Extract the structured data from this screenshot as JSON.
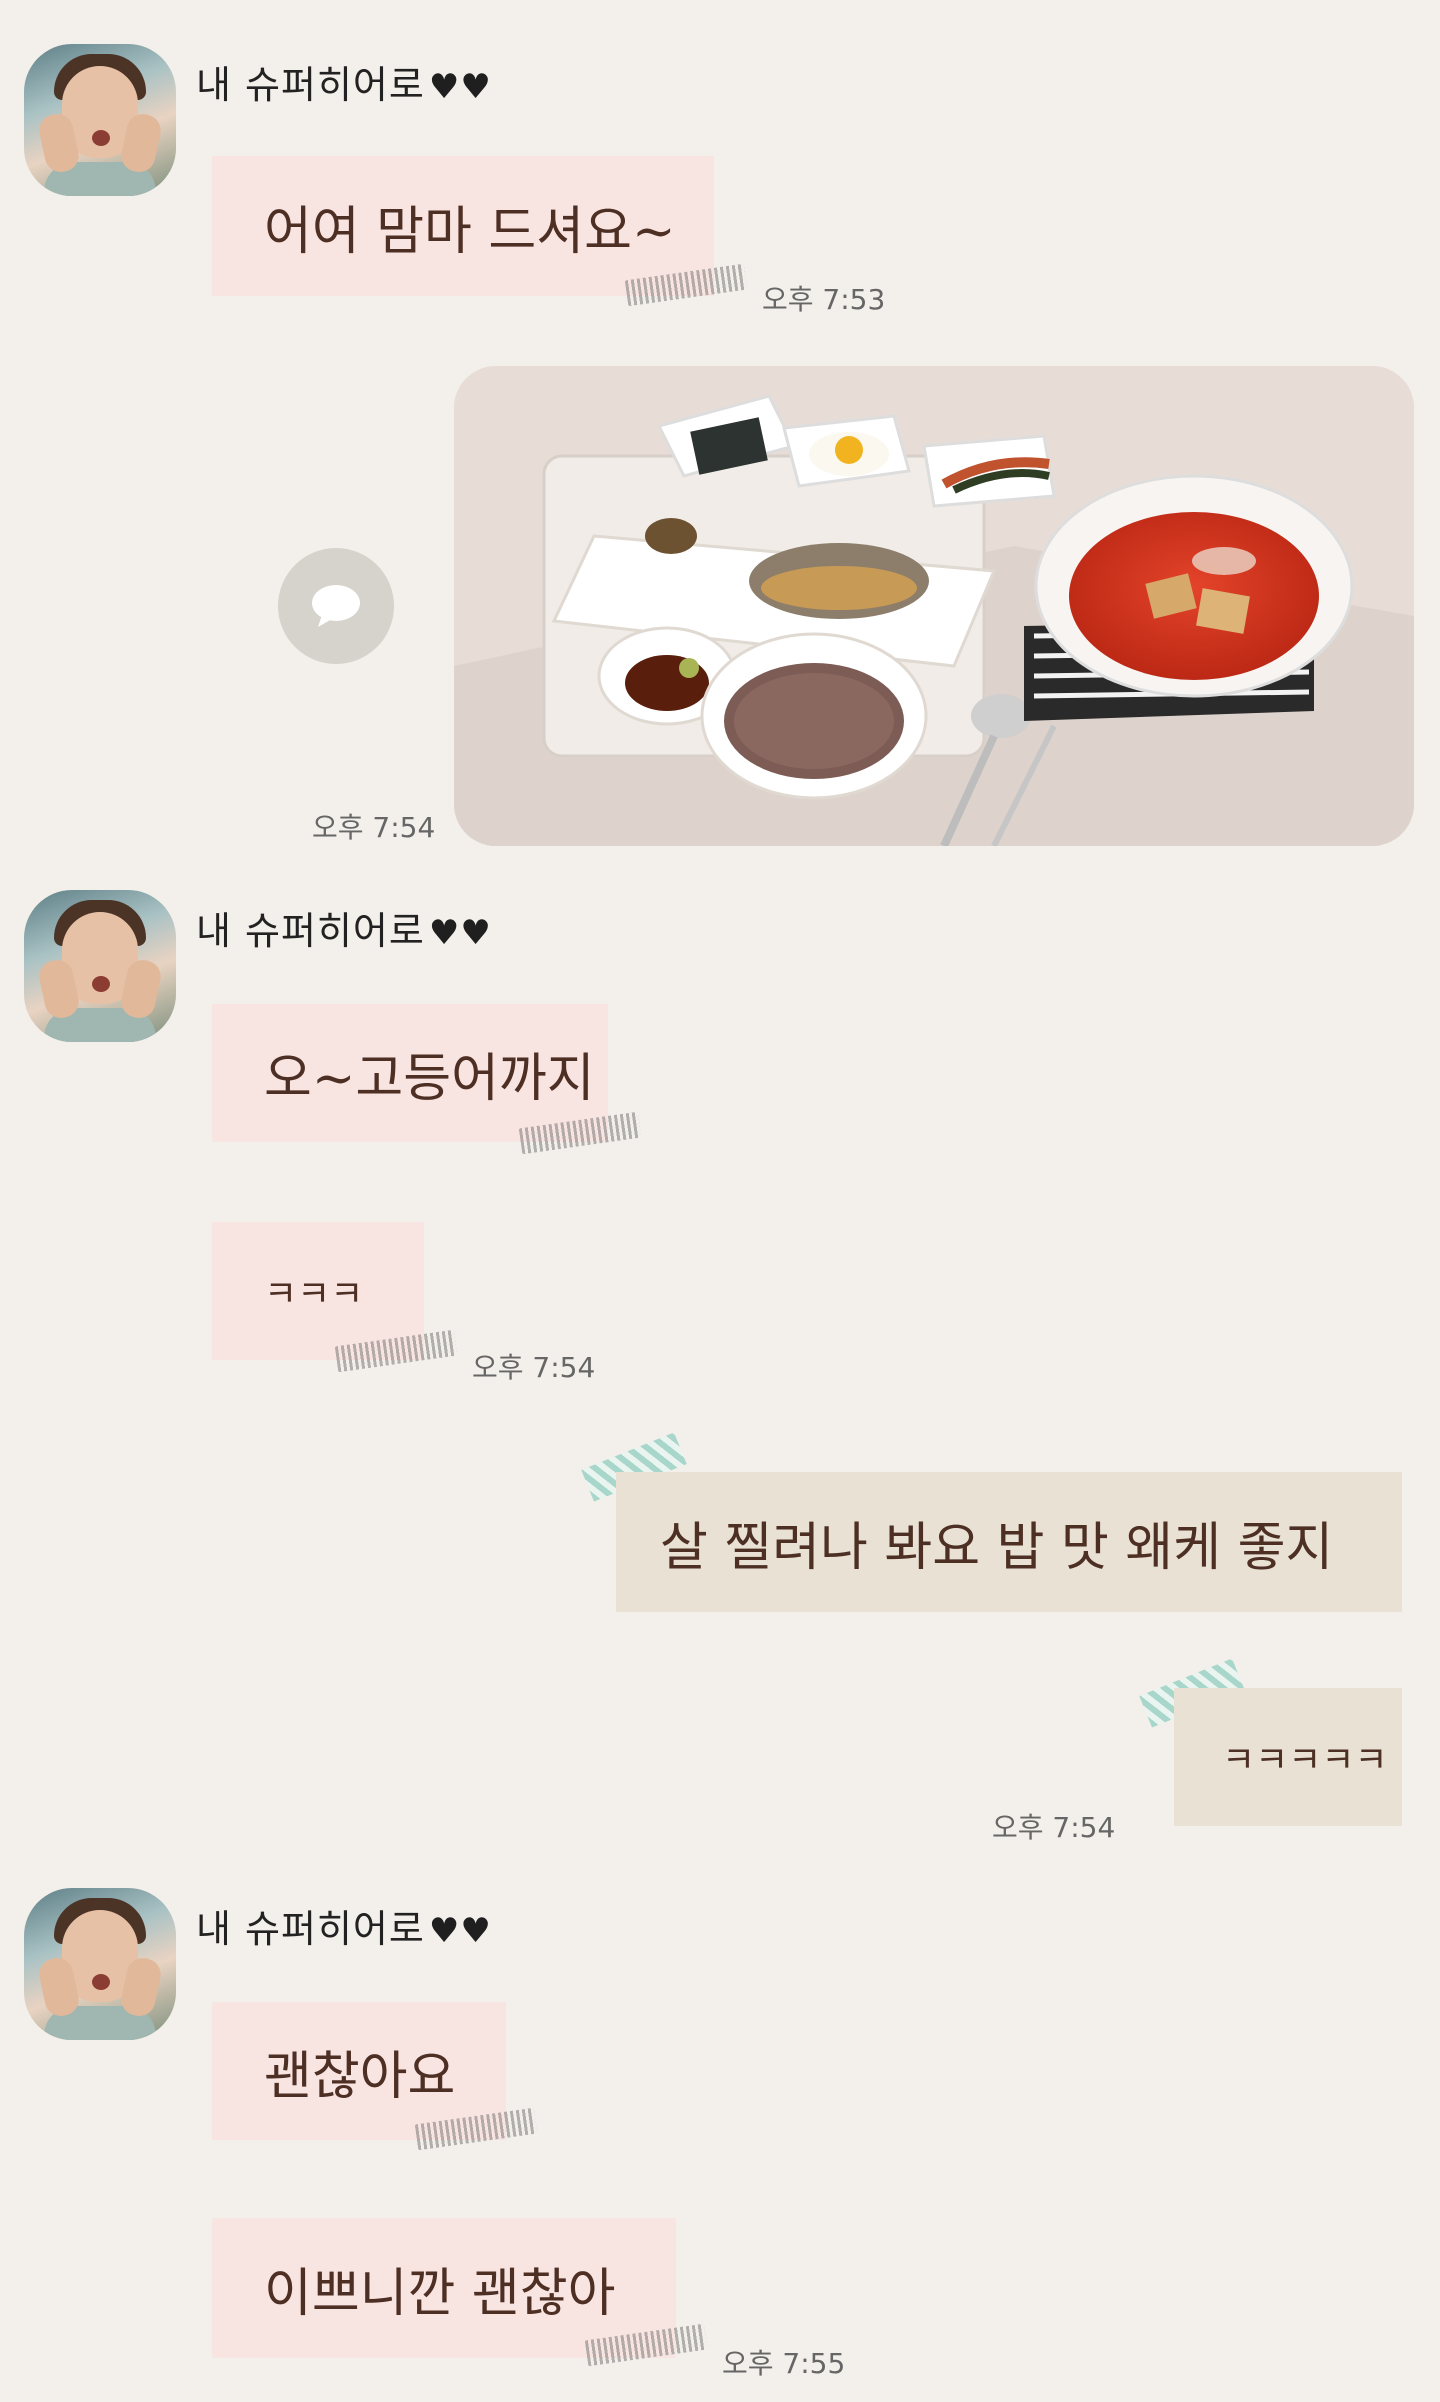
{
  "chat": {
    "sender_name": "내 슈퍼히어로",
    "sender_hearts": "♥♥",
    "messages": [
      {
        "text": "어여 맘마 드셔요~",
        "time": "오후 7:53"
      },
      {
        "time": "오후 7:54"
      },
      {
        "text": "오~고등어까지"
      },
      {
        "text": "ㅋㅋㅋ",
        "time": "오후 7:54"
      },
      {
        "text": "살 찔려나 봐요 밥 맛 왜케 좋지"
      },
      {
        "text": "ㅋㅋㅋㅋㅋ",
        "time": "오후 7:54"
      },
      {
        "text": "괜찮아요"
      },
      {
        "text": "이쁘니깐 괜찮아",
        "time": "오후 7:55"
      }
    ]
  },
  "colors": {
    "background": "#f3efea",
    "incoming_bubble": "#f8e4e1",
    "outgoing_bubble": "#e8e1d4",
    "washi_tape": "#9fd3c7"
  },
  "icons": {
    "share": "speech-bubble-icon",
    "avatar": "profile-photo"
  }
}
